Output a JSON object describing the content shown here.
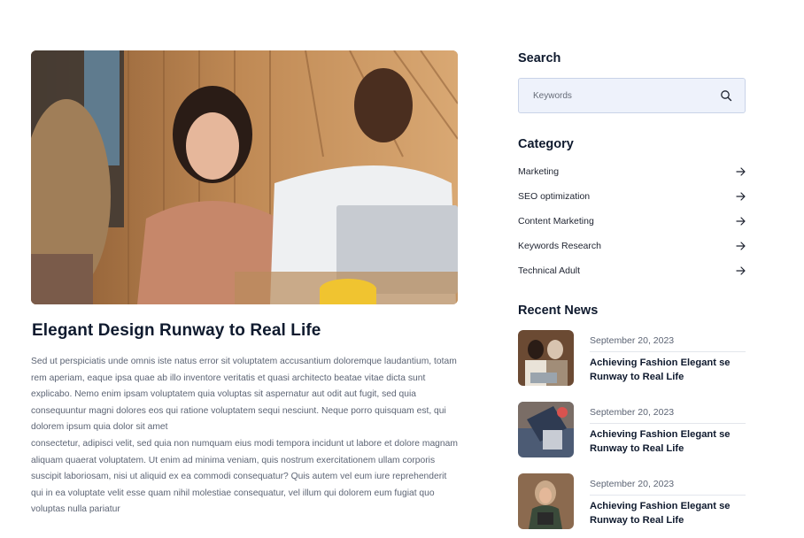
{
  "post": {
    "title": "Elegant Design Runway to Real Life",
    "paragraph_1": "Sed ut perspiciatis unde omnis iste natus error sit voluptatem accusantium doloremque laudantium, totam rem aperiam, eaque ipsa quae ab illo inventore veritatis et quasi architecto beatae vitae dicta sunt explicabo. Nemo enim ipsam voluptatem quia voluptas sit aspernatur aut odit aut fugit, sed quia consequuntur magni dolores eos qui ratione voluptatem sequi nesciunt. Neque porro quisquam est, qui dolorem ipsum quia dolor sit amet",
    "paragraph_2": "consectetur, adipisci velit, sed quia non numquam eius modi tempora incidunt ut labore et dolore magnam aliquam quaerat voluptatem. Ut enim ad minima veniam, quis nostrum exercitationem ullam corporis suscipit laboriosam, nisi ut aliquid ex ea commodi consequatur? Quis autem vel eum iure reprehenderit qui in ea voluptate velit esse quam nihil molestiae consequatur, vel illum qui dolorem eum fugiat quo voluptas nulla pariatur"
  },
  "sidebar": {
    "search": {
      "heading": "Search",
      "placeholder": "Keywords",
      "icon": "search-icon"
    },
    "category": {
      "heading": "Category",
      "items": [
        {
          "label": "Marketing",
          "icon": "arrow-right-icon"
        },
        {
          "label": "SEO optimization",
          "icon": "arrow-right-icon"
        },
        {
          "label": "Content Marketing",
          "icon": "arrow-right-icon"
        },
        {
          "label": "Keywords Research",
          "icon": "arrow-right-icon"
        },
        {
          "label": "Technical Adult",
          "icon": "arrow-right-icon"
        }
      ]
    },
    "recent_news": {
      "heading": "Recent News",
      "items": [
        {
          "date": "September 20, 2023",
          "title": "Achieving Fashion Elegant se Runway to Real Life"
        },
        {
          "date": "September 20, 2023",
          "title": "Achieving Fashion Elegant se Runway to Real Life"
        },
        {
          "date": "September 20, 2023",
          "title": "Achieving Fashion Elegant se Runway to Real Life"
        }
      ]
    }
  },
  "colors": {
    "heading": "#0f1a2e",
    "body_text": "#5c6474",
    "search_bg": "#eef2fb",
    "search_border": "#c9d3e8"
  }
}
